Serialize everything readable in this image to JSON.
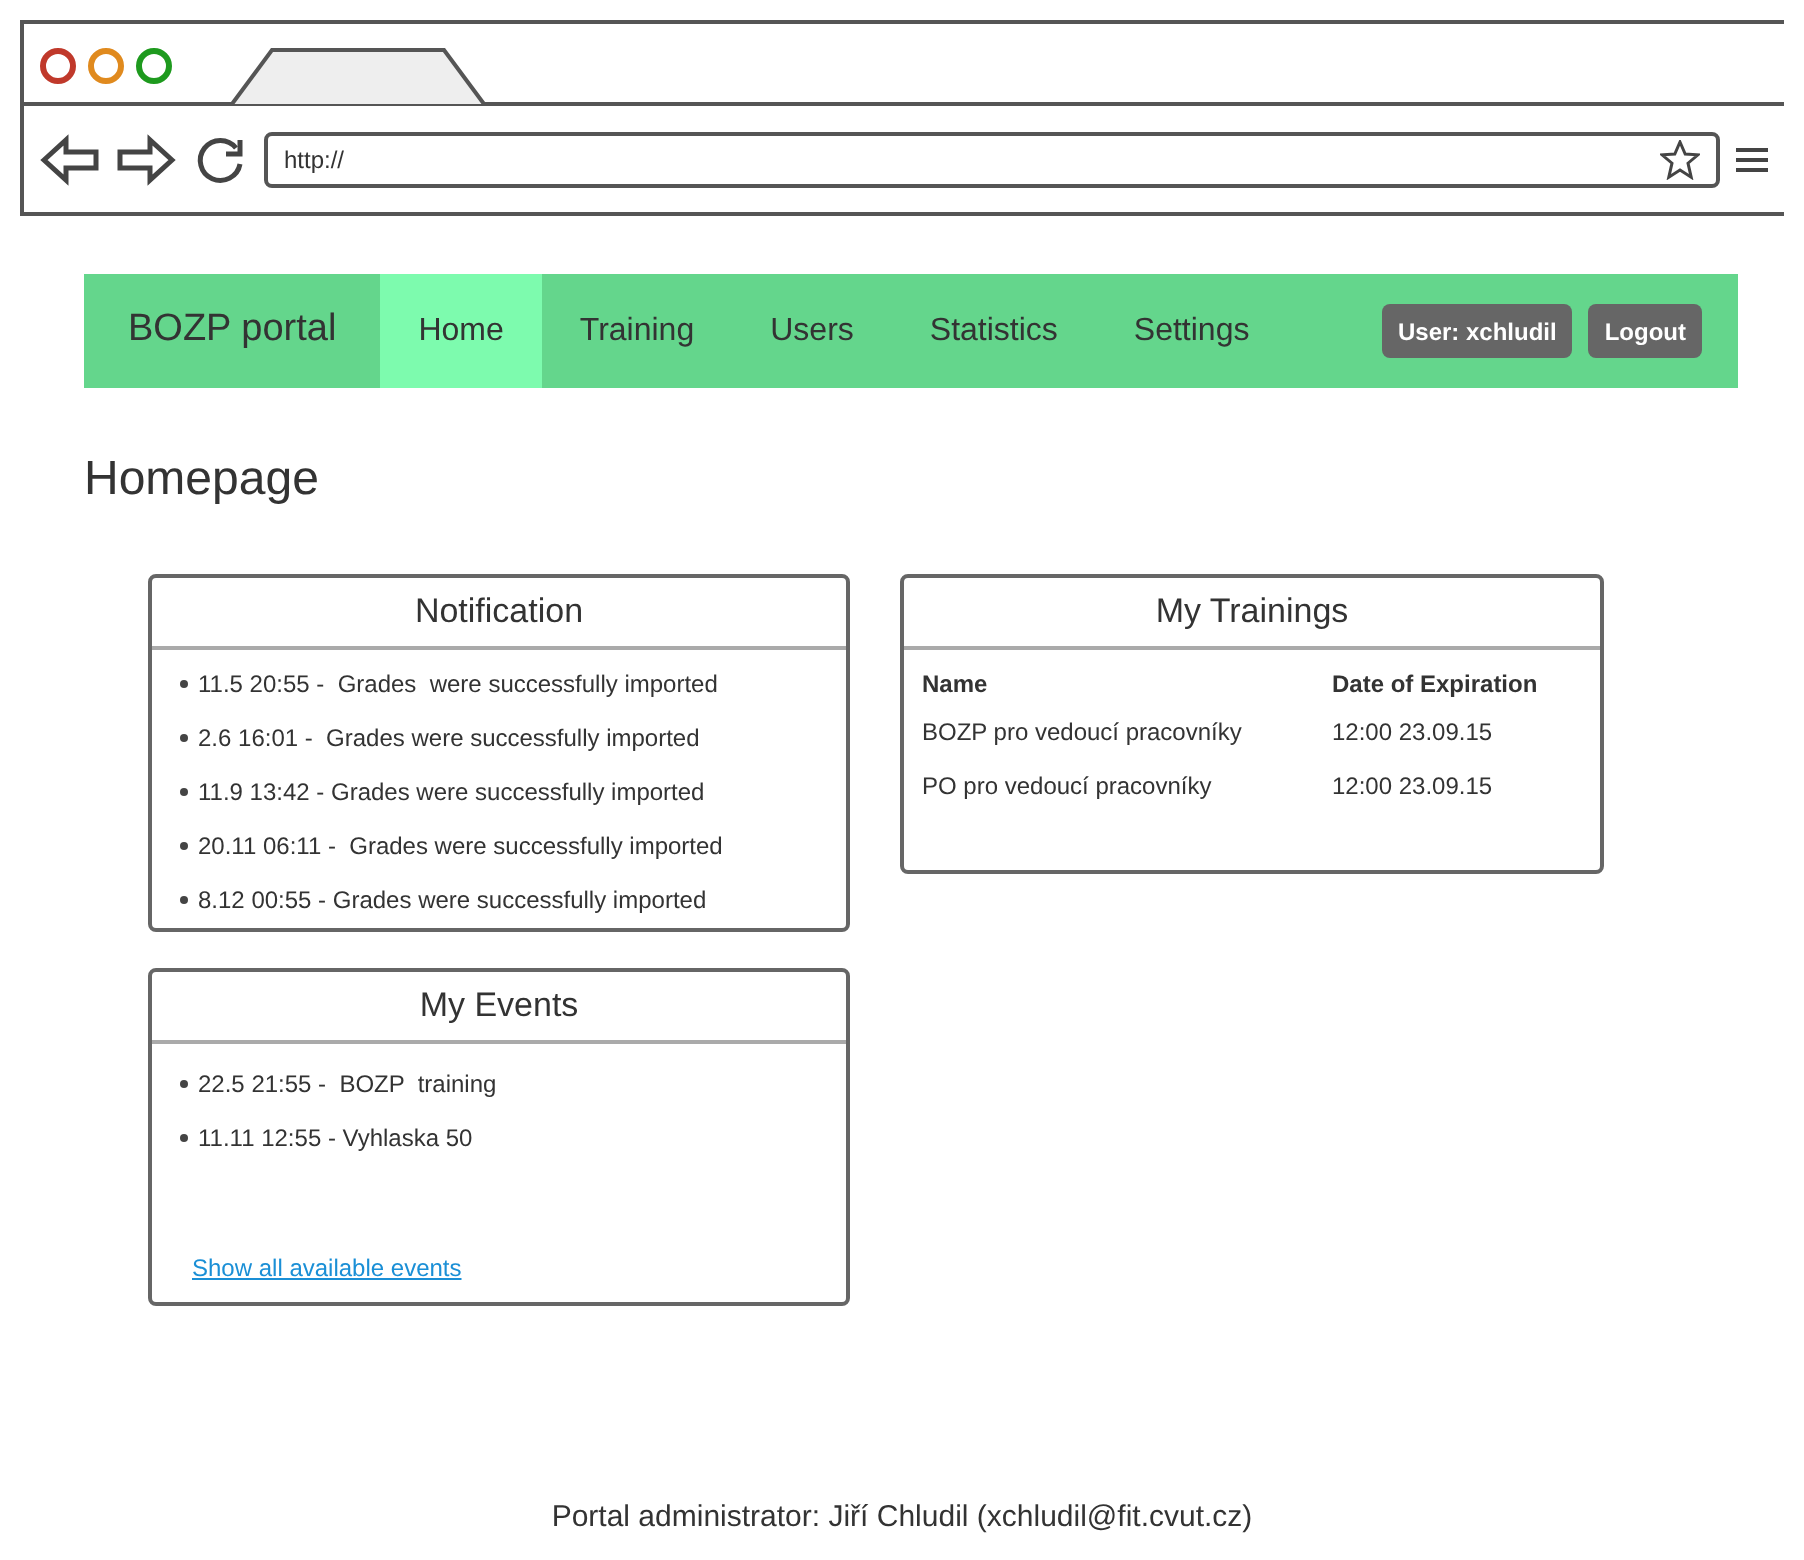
{
  "browser": {
    "url": "http://"
  },
  "navbar": {
    "brand": "BOZP portal",
    "items": [
      {
        "label": "Home",
        "selected": true
      },
      {
        "label": "Training",
        "selected": false
      },
      {
        "label": "Users",
        "selected": false
      },
      {
        "label": "Statistics",
        "selected": false
      },
      {
        "label": "Settings",
        "selected": false
      }
    ],
    "user_button": "User: xchludil",
    "logout_button": "Logout"
  },
  "heading": "Homepage",
  "notification": {
    "title": "Notification",
    "items": [
      "11.5 20:55 -  Grades  were successfully imported",
      "2.6 16:01 -  Grades were successfully imported",
      "11.9 13:42 - Grades were successfully imported",
      "20.11 06:11 -  Grades were successfully imported",
      "8.12 00:55 - Grades were successfully imported"
    ]
  },
  "my_events": {
    "title": "My Events",
    "items": [
      "22.5 21:55 -  BOZP  training",
      "11.11 12:55 - Vyhlaska 50"
    ],
    "link": "Show all available events"
  },
  "my_trainings": {
    "title": "My Trainings",
    "columns": [
      "Name",
      "Date of Expiration"
    ],
    "rows": [
      [
        "BOZP pro vedoucí pracovníky",
        "12:00 23.09.15"
      ],
      [
        "PO pro vedoucí pracovníky",
        "12:00 23.09.15"
      ]
    ]
  },
  "footer": "Portal administrator: Jiří Chludil (xchludil@fit.cvut.cz)"
}
